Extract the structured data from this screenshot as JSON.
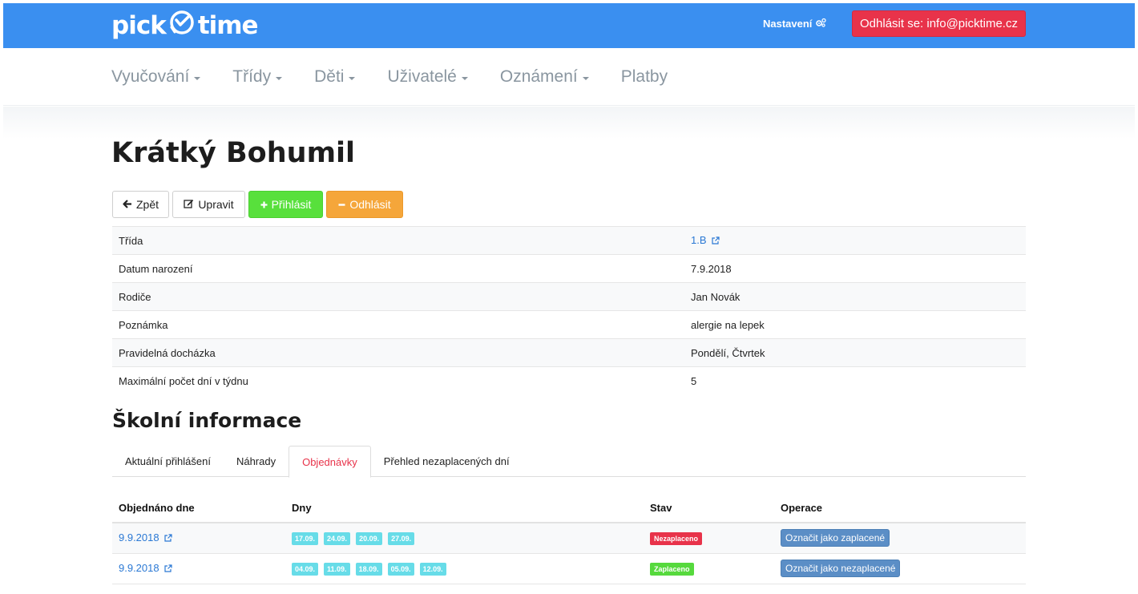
{
  "header": {
    "logo_left": "pick",
    "logo_right": "time",
    "settings_label": "Nastavení",
    "logout_label": "Odhlásit se: info@picktime.cz"
  },
  "nav": {
    "items": [
      {
        "label": "Vyučování",
        "dropdown": true
      },
      {
        "label": "Třídy",
        "dropdown": true
      },
      {
        "label": "Děti",
        "dropdown": true
      },
      {
        "label": "Uživatelé",
        "dropdown": true
      },
      {
        "label": "Oznámení",
        "dropdown": true
      },
      {
        "label": "Platby",
        "dropdown": false
      }
    ]
  },
  "page": {
    "title": "Krátký Bohumil"
  },
  "actions": {
    "back": "Zpět",
    "edit": "Upravit",
    "enroll": "Přihlásit",
    "unenroll": "Odhlásit"
  },
  "details": [
    {
      "label": "Třída",
      "value": "1.B"
    },
    {
      "label": "Datum narození",
      "value": "7.9.2018"
    },
    {
      "label": "Rodiče",
      "value": "Jan Novák"
    },
    {
      "label": "Poznámka",
      "value": "alergie na lepek"
    },
    {
      "label": "Pravidelná docházka",
      "value": "Pondělí, Čtvrtek"
    },
    {
      "label": "Maximální počet dní v týdnu",
      "value": "5"
    }
  ],
  "school": {
    "title": "Školní informace",
    "tabs": [
      {
        "label": "Aktuální přihlášení"
      },
      {
        "label": "Náhrady"
      },
      {
        "label": "Objednávky"
      },
      {
        "label": "Přehled nezaplacených dní"
      }
    ],
    "active_tab": "Objednávky"
  },
  "orders": {
    "headers": [
      "Objednáno dne",
      "Dny",
      "Stav",
      "Operace"
    ],
    "rows": [
      {
        "date": "9.9.2018",
        "days": [
          "17.09.",
          "24.09.",
          "20.09.",
          "27.09."
        ],
        "status": "Nezaplaceno",
        "action": "Označit jako zaplacené"
      },
      {
        "date": "9.9.2018",
        "days": [
          "04.09.",
          "11.09.",
          "18.09.",
          "05.09.",
          "12.09."
        ],
        "status": "Zaplaceno",
        "action": "Označit jako nezaplacené"
      }
    ]
  },
  "colors": {
    "header_bg": "#3a8ff0",
    "danger": "#e8334a",
    "success": "#56d93d",
    "warning": "#f5a63a",
    "info_label": "#67dce8",
    "primary_btn": "#5b8ec6",
    "link": "#2a78d4"
  }
}
